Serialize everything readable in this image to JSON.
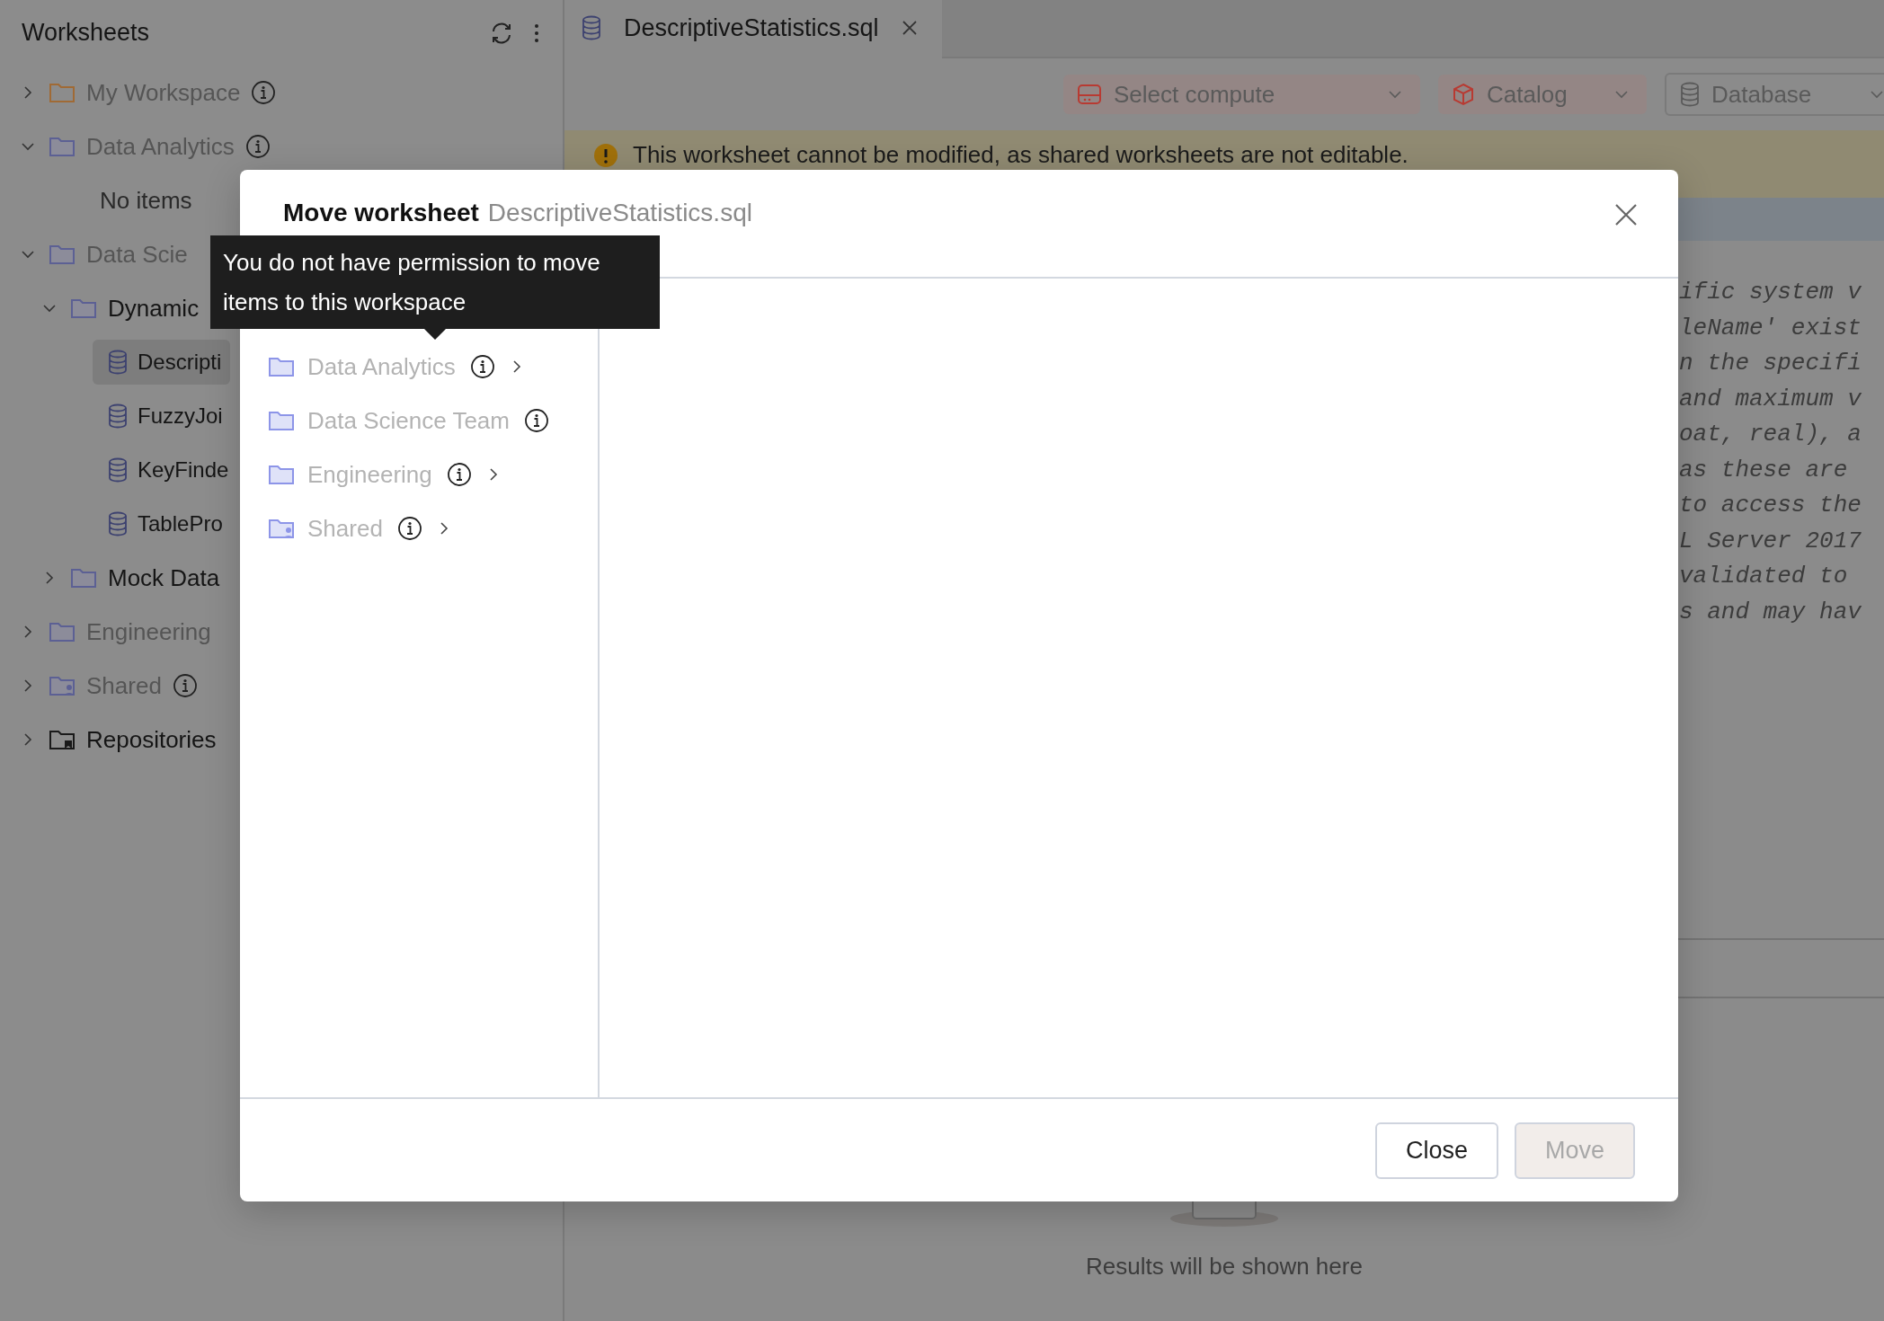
{
  "sidebar": {
    "title": "Worksheets",
    "tree": [
      {
        "kind": "personal",
        "label": "My Workspace",
        "info": true,
        "disabled": true,
        "expanded": false
      },
      {
        "kind": "folder",
        "label": "Data Analytics",
        "info": true,
        "disabled": true,
        "expanded": true,
        "children": [
          {
            "kind": "empty",
            "label": "No items"
          }
        ]
      },
      {
        "kind": "folder",
        "label": "Data Scie",
        "info": false,
        "disabled": true,
        "expanded": true,
        "children": [
          {
            "kind": "folder",
            "label": "Dynamic",
            "info": false,
            "disabled": false,
            "expanded": true,
            "children": [
              {
                "kind": "file",
                "label": "Descripti",
                "selected": true
              },
              {
                "kind": "file",
                "label": "FuzzyJoi",
                "selected": false
              },
              {
                "kind": "file",
                "label": "KeyFinde",
                "selected": false
              },
              {
                "kind": "file",
                "label": "TablePro",
                "selected": false
              }
            ]
          },
          {
            "kind": "folder",
            "label": "Mock Data",
            "info": false,
            "disabled": false,
            "expanded": false
          }
        ]
      },
      {
        "kind": "folder",
        "label": "Engineering",
        "info": false,
        "disabled": true,
        "expanded": false
      },
      {
        "kind": "shared",
        "label": "Shared",
        "info": true,
        "disabled": true,
        "expanded": false
      },
      {
        "kind": "repo",
        "label": "Repositories",
        "info": false,
        "disabled": false,
        "expanded": false
      }
    ]
  },
  "tabs": [
    {
      "label": "DescriptiveStatistics.sql",
      "selected": true
    }
  ],
  "toolbar": [
    {
      "kind": "compute",
      "label": "Select compute"
    },
    {
      "kind": "catalog",
      "label": "Catalog"
    },
    {
      "kind": "database",
      "label": "Database"
    }
  ],
  "banner": {
    "text": "This worksheet cannot be modified, as shared worksheets are not editable."
  },
  "editor": {
    "lines": [
      "ific system v",
      "leName' exist",
      "n the specifi",
      "and maximum v",
      "oat, real), a",
      "as these are",
      "to access the",
      "L Server 2017",
      "validated to",
      "s and may hav"
    ]
  },
  "results": {
    "empty_message": "Results will be shown here"
  },
  "dialog": {
    "title": "Move worksheet",
    "subtitle": "DescriptiveStatistics.sql",
    "items": [
      {
        "kind": "folder",
        "label": "Data Analytics",
        "info": true,
        "has_children": true,
        "disabled": true
      },
      {
        "kind": "folder",
        "label": "Data Science Team",
        "info": true,
        "has_children": false,
        "disabled": true
      },
      {
        "kind": "folder",
        "label": "Engineering",
        "info": true,
        "has_children": true,
        "disabled": true
      },
      {
        "kind": "shared",
        "label": "Shared",
        "info": true,
        "has_children": true,
        "disabled": true
      }
    ],
    "buttons": [
      {
        "label": "Close",
        "disabled": false
      },
      {
        "label": "Move",
        "disabled": true
      }
    ]
  },
  "tooltip": {
    "text": "You do not have permission to move items to this workspace"
  }
}
